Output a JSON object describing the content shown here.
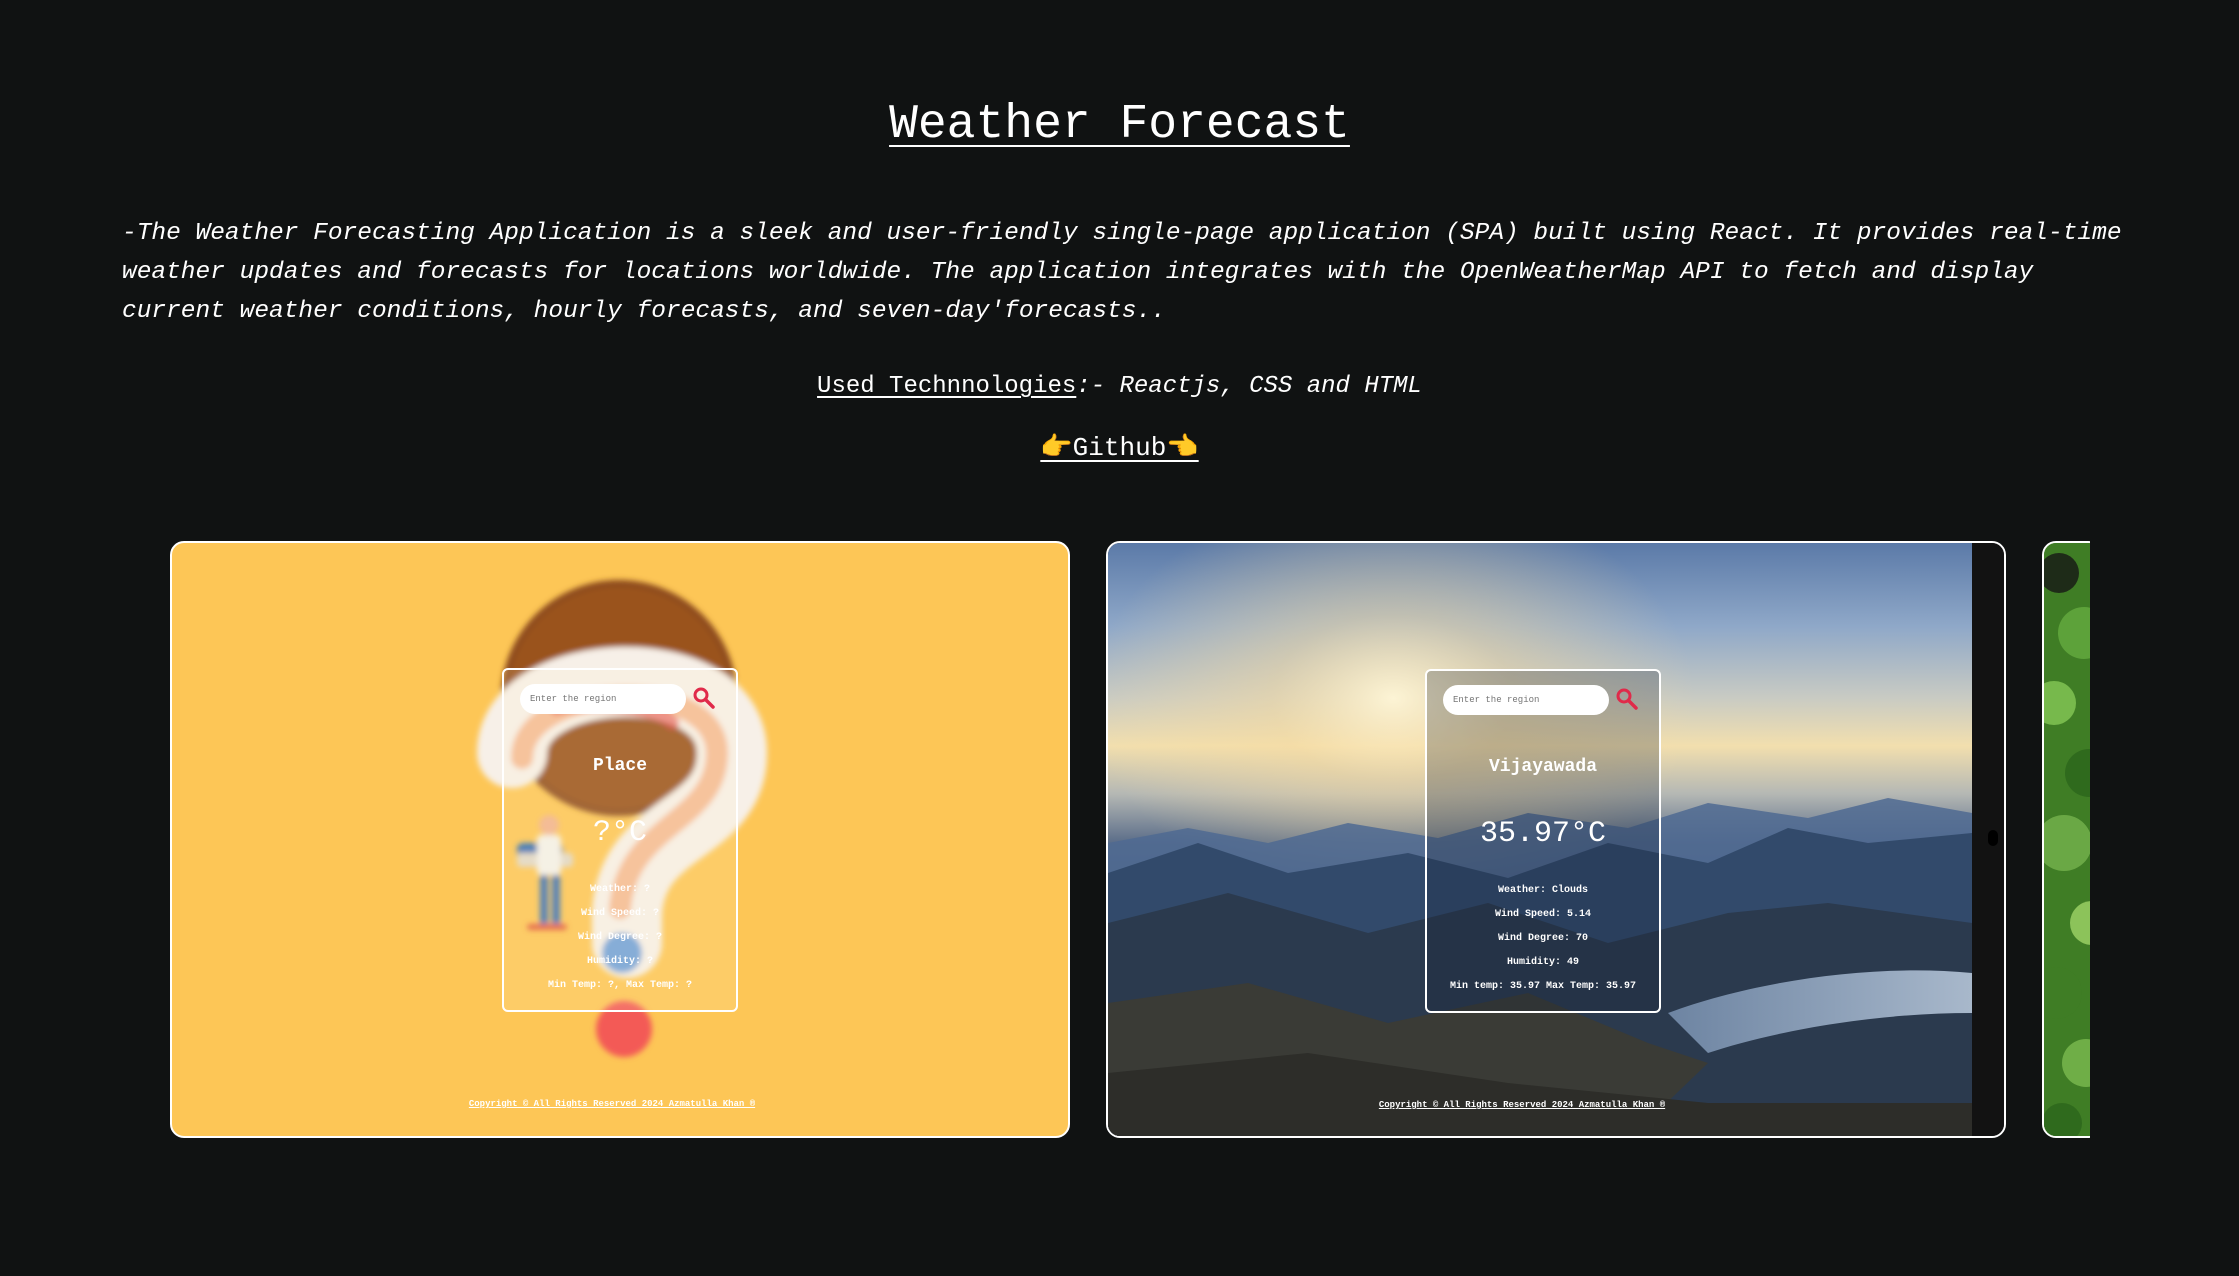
{
  "page": {
    "title": "Weather Forecast",
    "description": "-The Weather Forecasting Application is a sleek and user-friendly single-page application (SPA) built using React. It provides real-time weather updates and forecasts for locations worldwide. The application integrates with the OpenWeatherMap API to fetch and display current weather conditions, hourly forecasts, and seven-day'forecasts..",
    "tech_label": "Used Technnologies",
    "tech_value": ":- Reactjs, CSS and HTML",
    "github_link": "👉Github👈"
  },
  "colors": {
    "background": "#101212",
    "slide1_background": "#fdc656",
    "search_icon": "#e02a4a"
  },
  "slides": [
    {
      "search_placeholder": "Enter the region",
      "place": "Place",
      "temp": "?°C",
      "weather": "Weather: ?",
      "wind_speed": "Wind Speed: ?",
      "wind_degree": "Wind Degree: ?",
      "humidity": "Humidity: ?",
      "minmax": "Min Temp: ?, Max Temp: ?",
      "copyright": "Copyright © All Rights Reserved 2024 Azmatulla Khan ®"
    },
    {
      "search_placeholder": "Enter the region",
      "place": "Vijayawada",
      "temp": "35.97°C",
      "weather": "Weather: Clouds",
      "wind_speed": "Wind Speed: 5.14",
      "wind_degree": "Wind Degree: 70",
      "humidity": "Humidity: 49",
      "minmax": "Min temp: 35.97 Max Temp: 35.97",
      "copyright": "Copyright © All Rights Reserved 2024 Azmatulla Khan ®"
    }
  ]
}
